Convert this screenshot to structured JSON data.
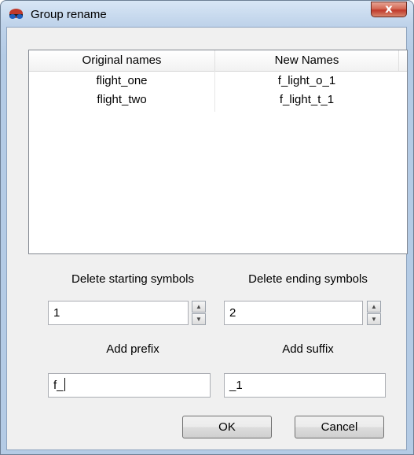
{
  "window": {
    "title": "Group rename",
    "close_symbol": "x"
  },
  "table": {
    "columns": [
      "Original names",
      "New Names"
    ],
    "rows": [
      {
        "original": "flight_one",
        "new": "f_light_o_1"
      },
      {
        "original": "flight_two",
        "new": "f_light_t_1"
      }
    ]
  },
  "fields": {
    "delete_start": {
      "label": "Delete starting symbols",
      "value": "1"
    },
    "delete_end": {
      "label": "Delete ending symbols",
      "value": "2"
    },
    "prefix": {
      "label": "Add prefix",
      "value": "f_"
    },
    "suffix": {
      "label": "Add suffix",
      "value": "_1"
    }
  },
  "buttons": {
    "ok": "OK",
    "cancel": "Cancel"
  },
  "icons": {
    "app": "sunglasses-icon",
    "spin_up": "arrow-up-icon",
    "spin_down": "arrow-down-icon"
  }
}
